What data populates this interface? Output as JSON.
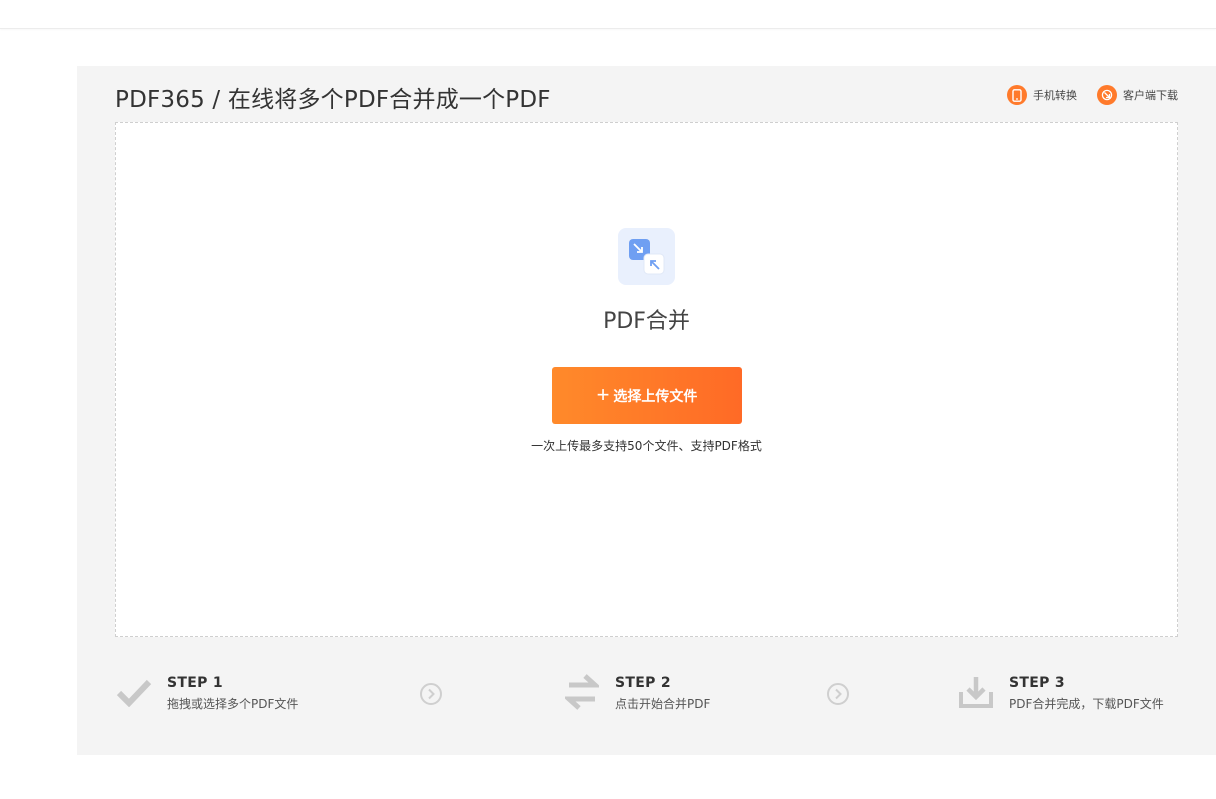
{
  "header": {
    "title": "PDF365 / 在线将多个PDF合并成一个PDF",
    "links": [
      {
        "label": "手机转换",
        "icon": "mobile-icon"
      },
      {
        "label": "客户端下载",
        "icon": "download-client-icon"
      }
    ]
  },
  "upload": {
    "tool_name": "PDF合并",
    "button_plus": "+",
    "button_label": "选择上传文件",
    "hint": "一次上传最多支持50个文件、支持PDF格式"
  },
  "steps": [
    {
      "title": "STEP 1",
      "desc": "拖拽或选择多个PDF文件",
      "icon": "checkmark-icon"
    },
    {
      "title": "STEP 2",
      "desc": "点击开始合并PDF",
      "icon": "swap-arrows-icon"
    },
    {
      "title": "STEP 3",
      "desc": "PDF合并完成，下载PDF文件",
      "icon": "download-tray-icon"
    }
  ],
  "colors": {
    "accent": "#ff7a2b",
    "panel_bg": "#f4f4f4",
    "tool_icon_bg": "#e9f0fd",
    "step_icon": "#c8c8c8"
  }
}
